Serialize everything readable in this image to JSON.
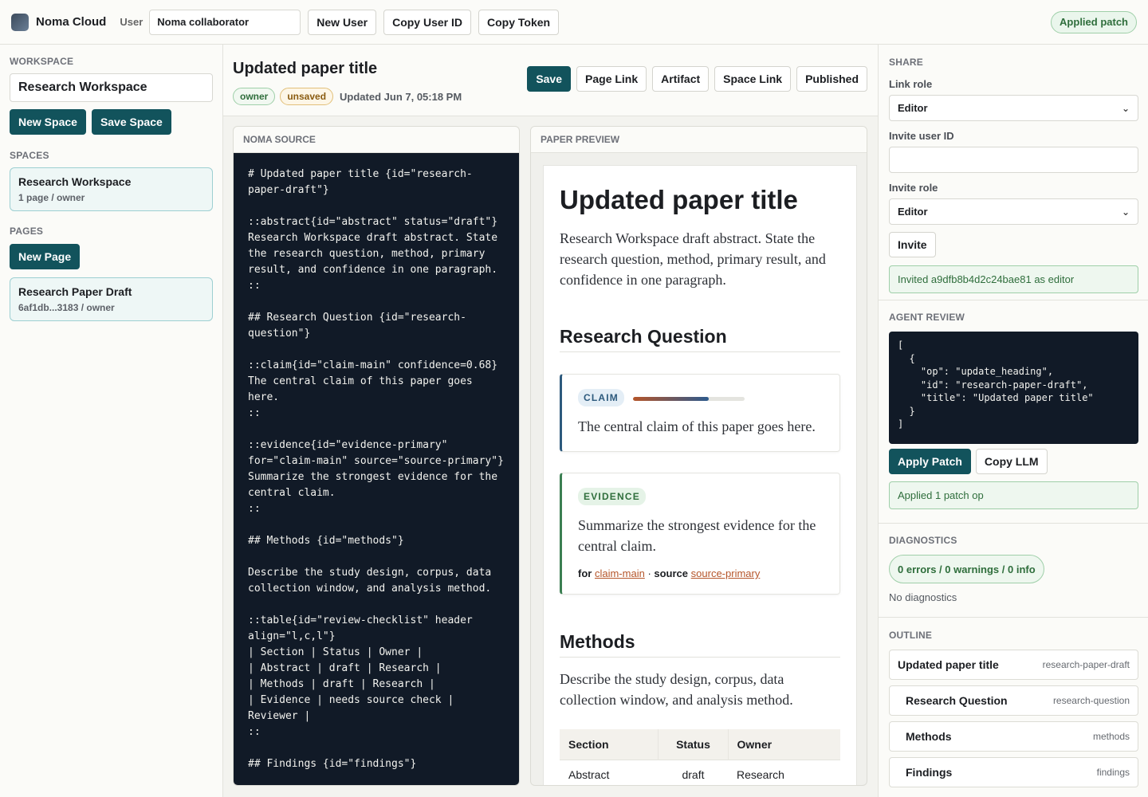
{
  "app": {
    "brand": "Noma Cloud",
    "user_label": "User",
    "user_value": "Noma collaborator"
  },
  "topbar": {
    "new_user": "New User",
    "copy_user_id": "Copy User ID",
    "copy_token": "Copy Token",
    "status": "Applied patch"
  },
  "sidebar": {
    "workspace_title": "WORKSPACE",
    "workspace_value": "Research Workspace",
    "new_space": "New Space",
    "save_space": "Save Space",
    "spaces_title": "SPACES",
    "spaces": [
      {
        "name": "Research Workspace",
        "meta": "1 page / owner"
      }
    ],
    "pages_title": "PAGES",
    "new_page": "New Page",
    "pages": [
      {
        "name": "Research Paper Draft",
        "meta": "6af1db...3183 / owner"
      }
    ]
  },
  "editor": {
    "title": "Updated paper title",
    "badge_owner": "owner",
    "badge_unsaved": "unsaved",
    "updated": "Updated Jun 7, 05:18 PM",
    "buttons": {
      "save": "Save",
      "page_link": "Page Link",
      "artifact": "Artifact",
      "space_link": "Space Link",
      "published": "Published"
    },
    "source_title": "NOMA SOURCE",
    "source": "# Updated paper title {id=\"research-paper-draft\"}\n\n::abstract{id=\"abstract\" status=\"draft\"}\nResearch Workspace draft abstract. State the research question, method, primary result, and confidence in one paragraph.\n::\n\n## Research Question {id=\"research-question\"}\n\n::claim{id=\"claim-main\" confidence=0.68}\nThe central claim of this paper goes here.\n::\n\n::evidence{id=\"evidence-primary\" for=\"claim-main\" source=\"source-primary\"}\nSummarize the strongest evidence for the central claim.\n::\n\n## Methods {id=\"methods\"}\n\nDescribe the study design, corpus, data collection window, and analysis method.\n\n::table{id=\"review-checklist\" header align=\"l,c,l\"}\n| Section | Status | Owner |\n| Abstract | draft | Research |\n| Methods | draft | Research |\n| Evidence | needs source check | Reviewer |\n::\n\n## Findings {id=\"findings\"}"
  },
  "preview": {
    "title": "PAPER PREVIEW",
    "h1": "Updated paper title",
    "abstract": "Research Workspace draft abstract. State the research question, method, primary result, and confidence in one paragraph.",
    "h2_question": "Research Question",
    "claim_tag": "CLAIM",
    "claim_confidence": 0.68,
    "claim_text": "The central claim of this paper goes here.",
    "evidence_tag": "EVIDENCE",
    "evidence_text": "Summarize the strongest evidence for the central claim.",
    "for_label": "for",
    "for_link": "claim-main",
    "source_label": "source",
    "source_link": "source-primary",
    "h2_methods": "Methods",
    "methods_text": "Describe the study design, corpus, data collection window, and analysis method.",
    "table": {
      "headers": [
        "Section",
        "Status",
        "Owner"
      ],
      "rows": [
        [
          "Abstract",
          "draft",
          "Research"
        ]
      ]
    }
  },
  "share": {
    "title": "SHARE",
    "link_role_label": "Link role",
    "link_role": "Editor",
    "invite_id_label": "Invite user ID",
    "invite_id": "",
    "invite_role_label": "Invite role",
    "invite_role": "Editor",
    "invite_btn": "Invite",
    "invite_notice": "Invited a9dfb8b4d2c24bae81 as editor"
  },
  "review": {
    "title": "AGENT REVIEW",
    "patch": "[\n  {\n    \"op\": \"update_heading\",\n    \"id\": \"research-paper-draft\",\n    \"title\": \"Updated paper title\"\n  }\n]",
    "apply": "Apply Patch",
    "copy_llm": "Copy LLM",
    "notice": "Applied 1 patch op"
  },
  "diagnostics": {
    "title": "DIAGNOSTICS",
    "summary": "0 errors / 0 warnings / 0 info",
    "empty": "No diagnostics"
  },
  "outline": {
    "title": "OUTLINE",
    "items": [
      {
        "title": "Updated paper title",
        "id": "research-paper-draft"
      },
      {
        "title": "Research Question",
        "id": "research-question"
      },
      {
        "title": "Methods",
        "id": "methods"
      },
      {
        "title": "Findings",
        "id": "findings"
      }
    ]
  }
}
